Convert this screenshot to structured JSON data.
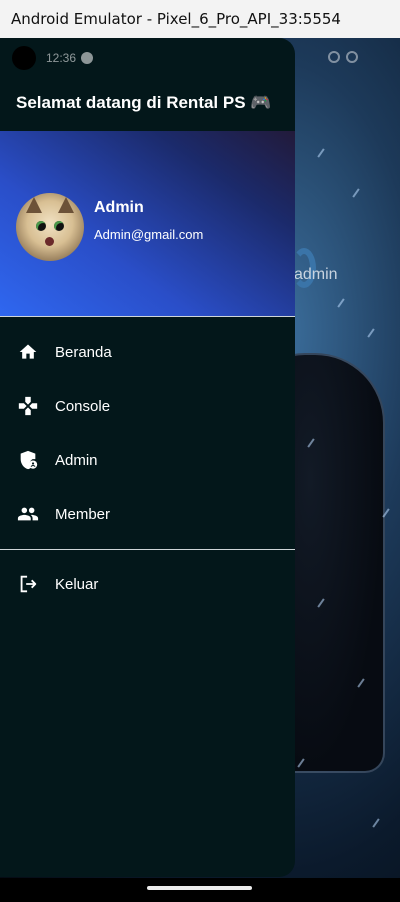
{
  "window": {
    "title": "Android Emulator - Pixel_6_Pro_API_33:5554"
  },
  "status_bar": {
    "time": "12:36"
  },
  "drawer": {
    "title": "Selamat datang di Rental PS 🎮",
    "user": {
      "name": "Admin",
      "email": "Admin@gmail.com"
    },
    "menu": [
      {
        "label": "Beranda",
        "icon": "home-icon"
      },
      {
        "label": "Console",
        "icon": "gamepad-icon"
      },
      {
        "label": "Admin",
        "icon": "admin-shield-icon"
      },
      {
        "label": "Member",
        "icon": "people-icon"
      }
    ],
    "logout": {
      "label": "Keluar",
      "icon": "logout-icon"
    }
  },
  "background": {
    "label": "admin"
  },
  "colors": {
    "drawer_bg": "#03171a",
    "header_gradient_start": "#2f67f0",
    "header_gradient_end": "#221a3a",
    "divider": "#cfd6d8"
  }
}
